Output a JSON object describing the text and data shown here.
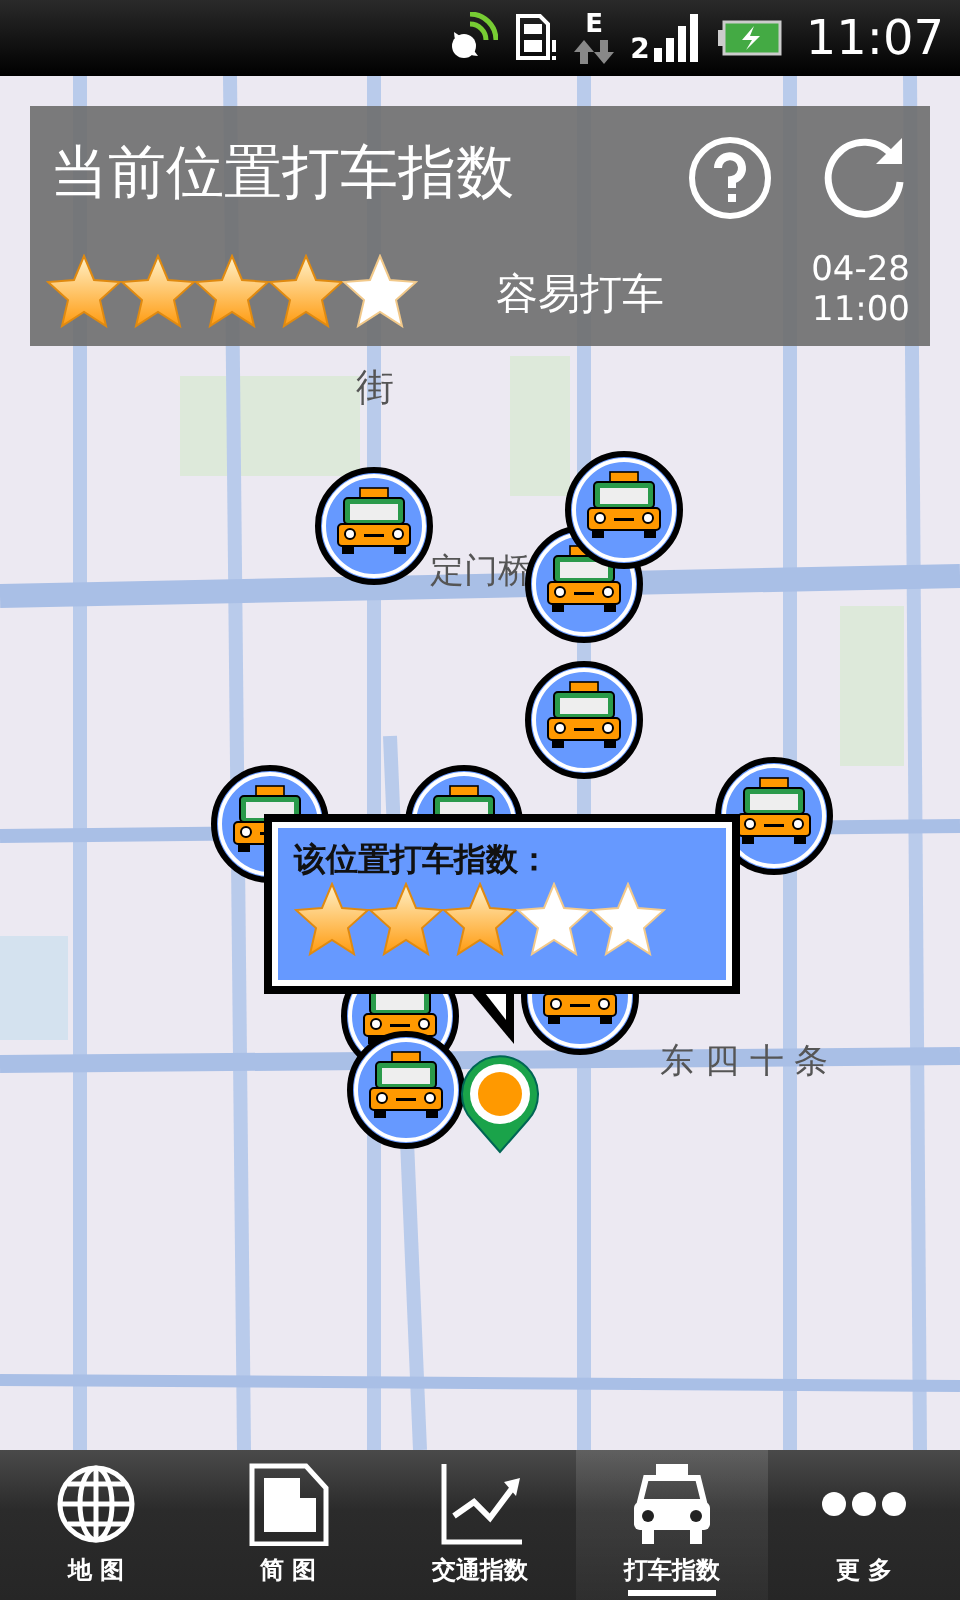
{
  "status_bar": {
    "network": "E",
    "signal_slot": "2",
    "time": "11:07"
  },
  "header": {
    "title": "当前位置打车指数",
    "stars": 4,
    "rating_text": "容易打车",
    "date": "04-28",
    "time": "11:00"
  },
  "map": {
    "labels": [
      {
        "text": "街",
        "kind": "vertical"
      },
      {
        "text": "定门桥",
        "kind": "horizontal"
      },
      {
        "text": "东 四 十 条",
        "kind": "horizontal"
      }
    ]
  },
  "popup": {
    "title": "该位置打车指数：",
    "stars": 3
  },
  "nav": [
    {
      "label": "地 图",
      "kind": "globe",
      "selected": false
    },
    {
      "label": "简 图",
      "kind": "page",
      "selected": false
    },
    {
      "label": "交通指数",
      "kind": "chart",
      "selected": false
    },
    {
      "label": "打车指数",
      "kind": "taxi",
      "selected": true
    },
    {
      "label": "更 多",
      "kind": "more",
      "selected": false
    }
  ]
}
